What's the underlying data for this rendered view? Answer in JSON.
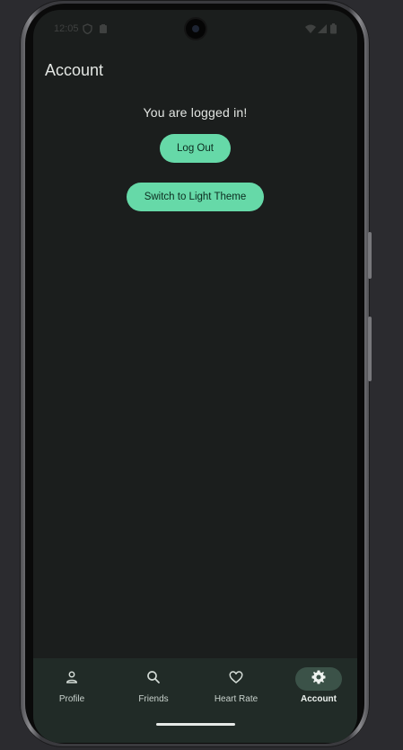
{
  "status_bar": {
    "time": "12:05",
    "icons": [
      "shield-icon",
      "clipboard-icon",
      "wifi-icon",
      "signal-icon",
      "battery-icon"
    ]
  },
  "app_bar": {
    "title": "Account"
  },
  "main": {
    "status_text": "You are logged in!",
    "logout_label": "Log Out",
    "theme_label": "Switch to Light Theme"
  },
  "bottom_nav": {
    "items": [
      {
        "label": "Profile",
        "icon": "person-icon",
        "active": false
      },
      {
        "label": "Friends",
        "icon": "search-icon",
        "active": false
      },
      {
        "label": "Heart Rate",
        "icon": "heart-icon",
        "active": false
      },
      {
        "label": "Account",
        "icon": "gear-icon",
        "active": true
      }
    ]
  },
  "colors": {
    "background": "#1b1e1d",
    "accent": "#66d9a8",
    "nav_background": "#212b27",
    "active_indicator": "#3b5248"
  }
}
